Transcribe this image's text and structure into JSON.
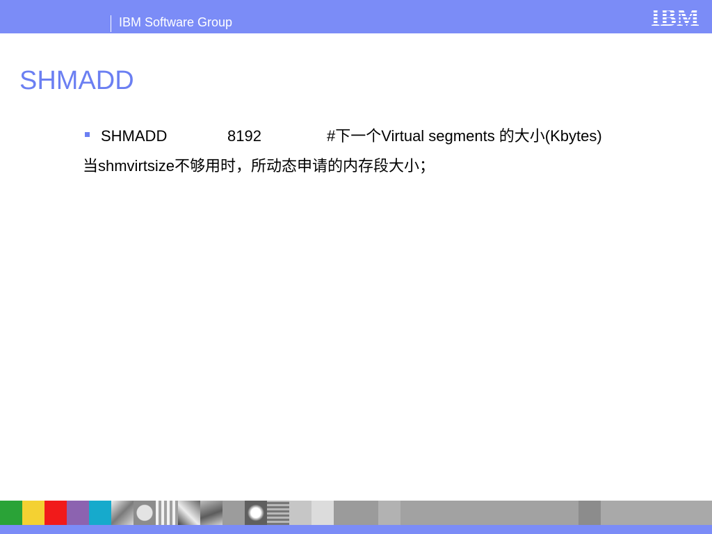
{
  "header": {
    "group_label": "IBM Software Group",
    "logo_text": "IBM",
    "bar_color": "#7b8cf7"
  },
  "slide": {
    "title": "SHMADD",
    "title_color": "#6b7ff2",
    "bullet": {
      "name": "SHMADD",
      "value": "8192",
      "comment": "#下一个Virtual segments 的大小(Kbytes)"
    },
    "sub_line": "当shmvirtsize不够用时，所动态申请的内存段大小；"
  },
  "footer": {
    "strip_colors": [
      "#2aa337",
      "#f4d132",
      "#f11a1a",
      "#8c63b0",
      "#16aacc"
    ]
  }
}
